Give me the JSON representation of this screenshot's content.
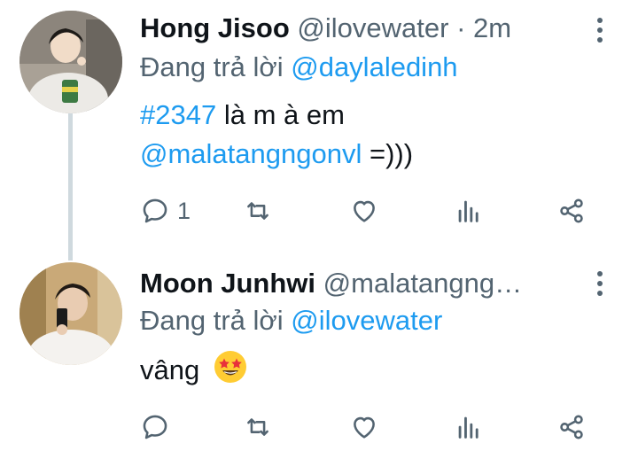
{
  "tweets": [
    {
      "name": "Hong Jisoo",
      "handle": "@ilovewater",
      "time": "· 2m",
      "replying_prefix": "Đang trả lời ",
      "replying_to": "@daylaledinh",
      "hashtag": "#2347",
      "text_part1": " là m à em",
      "mention": "@malatangngonvl",
      "text_part2": " =)))",
      "reply_count": "1"
    },
    {
      "name": "Moon Junhwi",
      "handle": "@malatangng…",
      "replying_prefix": "Đang trả lời ",
      "replying_to": "@ilovewater",
      "text": "vâng",
      "emoji": "star-struck-emoji",
      "reply_count": ""
    }
  ],
  "icons": {
    "reply": "reply-icon",
    "retweet": "retweet-icon",
    "like": "heart-icon",
    "views": "views-icon",
    "share": "share-icon",
    "more": "more-vertical-icon"
  },
  "colors": {
    "link": "#1d9bf0",
    "secondary": "#536471",
    "thread_line": "#cfd9de"
  }
}
